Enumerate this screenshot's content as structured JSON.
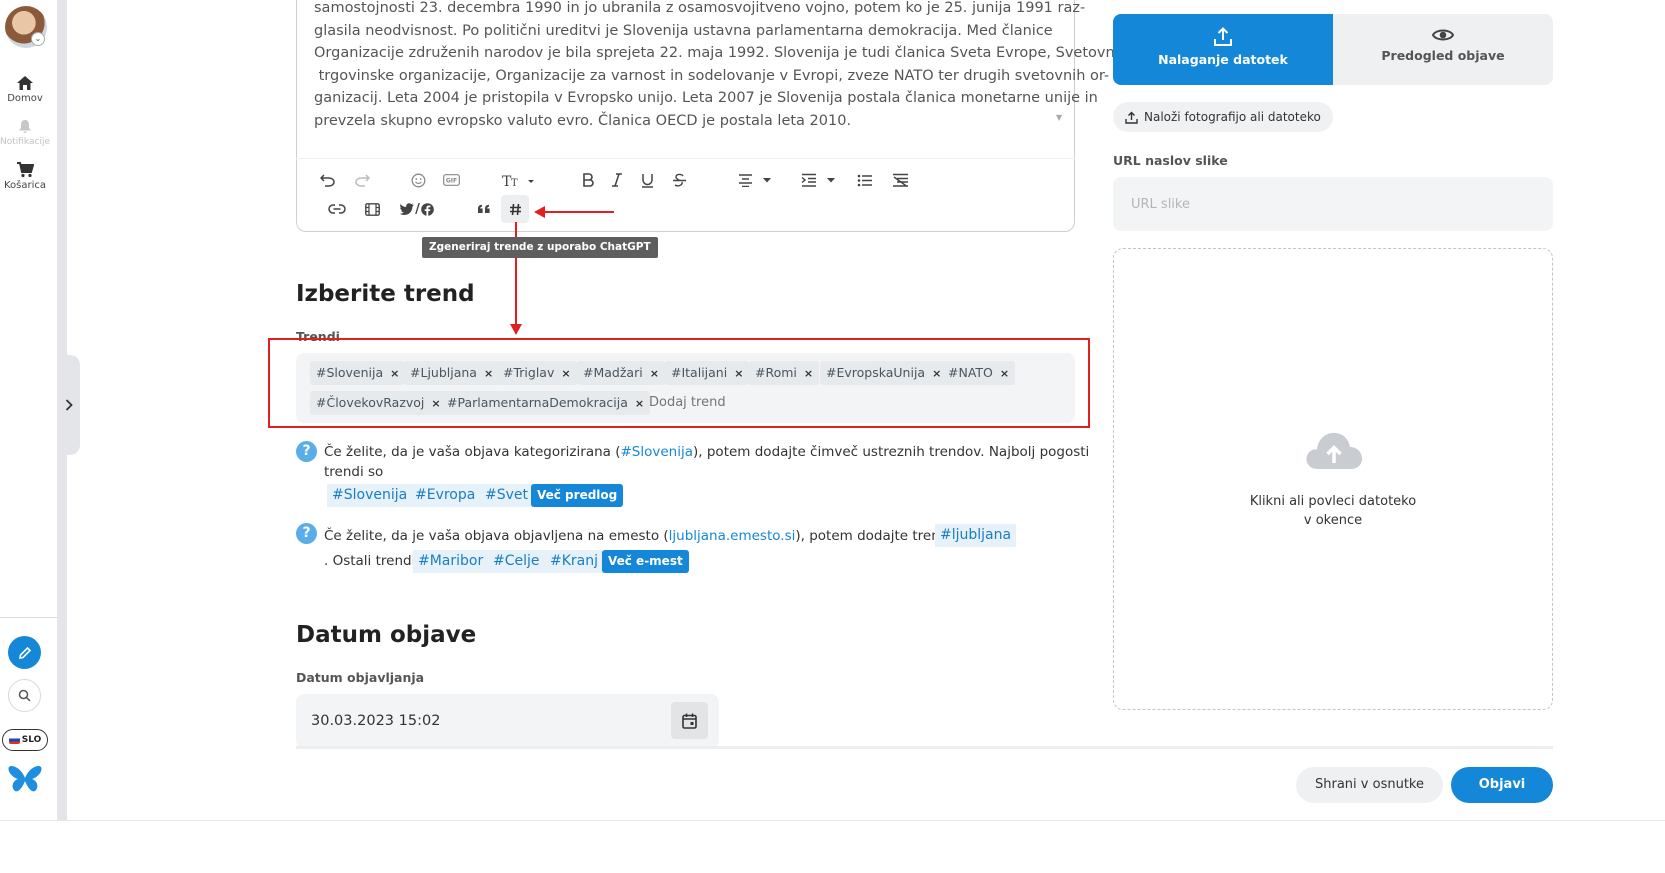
{
  "sidebar": {
    "items": [
      {
        "label": "Domov",
        "icon": "home-icon"
      },
      {
        "label": "Notifikacije",
        "icon": "bell-icon"
      },
      {
        "label": "Košarica",
        "icon": "cart-icon"
      }
    ],
    "language": "SLO"
  },
  "editor": {
    "lines": [
      "samostojnosti 23. decembra 1990 in jo ubranila z osamosvojitveno vojno, potem ko je 25. junija 1991 raz-",
      "glasila neodvisnost. Po politični ureditvi je Slovenija ustavna parlamentarna demokracija. Med članice",
      "Organizacije združenih narodov je bila sprejeta 22. maja 1992. Slovenija je tudi članica Sveta Evrope, Svetovne",
      " trgovinske organizacije, Organizacije za varnost in sodelovanje v Evropi, zveze NATO ter drugih svetovnih or-",
      "ganizacij. Leta 2004 je pristopila v Evropsko unijo. Leta 2007 je Slovenija postala članica monetarne unije in",
      "prevzela skupno evropsko valuto evro. Članica OECD je postala leta 2010."
    ],
    "tooltip": "Zgeneriraj trende z uporabo ChatGPT",
    "twitter_facebook": "/"
  },
  "trends": {
    "title": "Izberite trend",
    "label": "Trendi",
    "tags": [
      "#Slovenija",
      "#Ljubljana",
      "#Triglav",
      "#Madžari",
      "#Italijani",
      "#Romi",
      "#EvropskaUnija",
      "#NATO",
      "#ČlovekovRazvoj",
      "#ParlamentarnaDemokracija"
    ],
    "add_placeholder": "Dodaj trend",
    "remove_symbol": "×",
    "hint1_prefix": "Če želite, da je vaša objava kategorizirana (",
    "hint1_link": "#Slovenija",
    "hint1_suffix": "), potem dodajte čimveč ustreznih trendov. Najbolj pogosti",
    "hint1_line2": "trendi so",
    "popular": [
      "#Slovenija",
      "#Evropa",
      "#Svet"
    ],
    "more_suggestions": "Več predlog",
    "hint2_prefix": "Če želite, da je vaša objava objavljena na emesto (",
    "hint2_link": "ljubljana.emesto.si",
    "hint2_suffix": "), potem dodajte trend",
    "hint2_tag": "#ljubljana",
    "hint2_line2": ". Ostali trendi",
    "cities": [
      "#Maribor",
      "#Celje",
      "#Kranj"
    ],
    "more_cities": "Več e-mest"
  },
  "publish_date": {
    "title": "Datum objave",
    "label": "Datum objavljanja",
    "value": "30.03.2023 15:02"
  },
  "media": {
    "tab_upload": "Nalaganje datotek",
    "tab_preview": "Predogled objave",
    "upload_button": "Naloži fotografijo ali datoteko",
    "url_label": "URL naslov slike",
    "url_placeholder": "URL slike",
    "dropzone_line1": "Klikni ali povleci datoteko",
    "dropzone_line2": "v okence"
  },
  "actions": {
    "draft": "Shrani v osnutke",
    "publish": "Objavi"
  },
  "colors": {
    "accent": "#1487d8",
    "highlight": "#e02020"
  }
}
